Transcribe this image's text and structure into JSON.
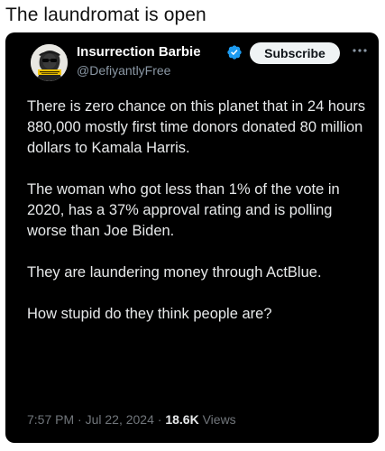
{
  "caption": "The laundromat is open",
  "post": {
    "author_name": "Insurrection Barbie",
    "handle": "@DefiyantlyFree",
    "subscribe_label": "Subscribe",
    "paragraphs": [
      "There is zero chance on this planet that in 24 hours 880,000 mostly first time donors donated 80 million dollars to Kamala Harris.",
      "The woman who got less than 1% of the vote in 2020, has a 37% approval rating and is polling worse than Joe Biden.",
      "They are laundering money through ActBlue.",
      "How stupid do they think people are?"
    ],
    "time": "7:57 PM",
    "separator": "·",
    "date": "Jul 22, 2024",
    "views_count": "18.6K",
    "views_label": "Views"
  },
  "icons": {
    "verified": "verified-badge-icon",
    "more": "more-options-icon",
    "avatar": "profile-avatar"
  },
  "colors": {
    "card_background": "#000000",
    "text_primary": "#e7e9ea",
    "text_secondary": "#71767b",
    "verified_blue": "#1d9bf0",
    "subscribe_bg": "#eff3f4"
  }
}
